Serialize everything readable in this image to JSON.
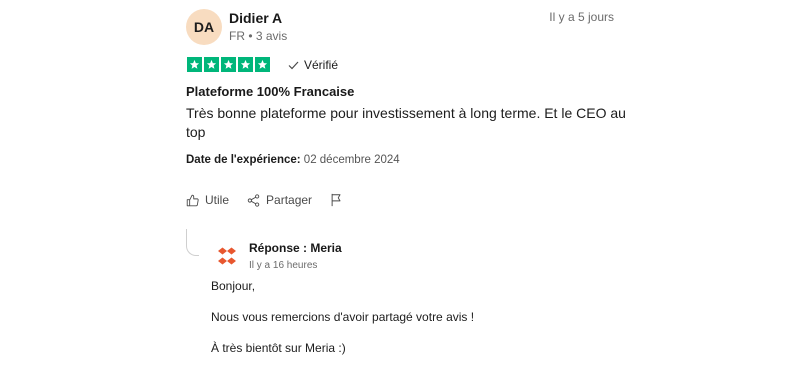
{
  "review": {
    "avatar_initials": "DA",
    "author": "Didier A",
    "meta": "FR • 3 avis",
    "date": "Il y a 5 jours",
    "rating": 5,
    "verified_label": "Vérifié",
    "title": "Plateforme 100% Francaise",
    "body": "Très bonne plateforme pour investissement à long terme. Et le CEO au top",
    "experience_label": "Date de l'expérience:",
    "experience_date": "02 décembre 2024",
    "useful_label": "Utile",
    "share_label": "Partager"
  },
  "reply": {
    "title": "Réponse : Meria",
    "date": "Il y a 16 heures",
    "paragraphs": [
      "Bonjour,",
      "Nous vous remercions d'avoir partagé votre avis !",
      "À très bientôt sur Meria :)"
    ]
  },
  "colors": {
    "star_green": "#00b67a",
    "avatar_bg": "#f8dcc0",
    "meria_orange": "#e8572f"
  }
}
